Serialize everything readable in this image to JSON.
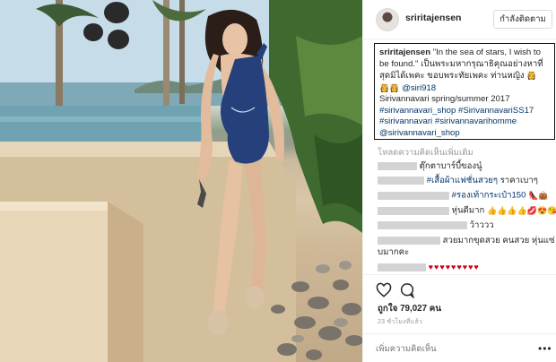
{
  "post": {
    "username": "sriritajensen",
    "follow_label": "กำลังติดตาม"
  },
  "caption": {
    "author": "sriritajensen",
    "line1_rest": "\"In the sea of stars, I wish to",
    "line2": "be found.\" เป็นพระมหากรุณาธิคุณอย่างหาที่",
    "line3": "สุดมิได้เพคะ ขอบพระทัยเพคะ ท่านหญิง",
    "line4_mention": "@siri918",
    "line5": "Sirivannavari spring/summer 2017",
    "line6_tag1": "#sirivannavari_shop",
    "line6_tag2": "#SirivannavariSS17",
    "line7_tag1": "#sirivannavari",
    "line7_tag2": "#sirivannavarihomme",
    "line8_mention": "@sirivannavari_shop"
  },
  "comments": {
    "load_more": "โหลดความคิดเห็นเพิ่มเติม",
    "c1_text": "ตุ๊กตาบาร์บี้ของนู๋",
    "c2_hashtag": "#เสื้อผ้าแฟชั่นสวยๆ",
    "c2_text": "ราคาเบาๆ",
    "c3_hashtag": "#รองเท้ากระเป๋า150",
    "c4_text": "หุ่นดีมาก",
    "c5_text": "ว้าววว",
    "c6_text": "สวยมากขุดสวย คนสวย หุ่นแซ่",
    "c6_cont": "บมากคะ",
    "c7_hearts": "♥♥♥♥♥♥♥♥♥"
  },
  "actions": {
    "like_icon": "heart-outline-icon",
    "comment_icon": "speech-bubble-icon",
    "likes_text": "ถูกใจ 79,027 คน",
    "time_text": "23 ชั่วโมงที่แล้ว",
    "add_comment_placeholder": "เพิ่มความคิดเห็น",
    "more_icon": "ellipsis-icon"
  },
  "colors": {
    "link": "#003569",
    "muted": "#999999",
    "border": "#efefef",
    "swimsuit": "#25407a",
    "heart_red": "#d0021b"
  }
}
